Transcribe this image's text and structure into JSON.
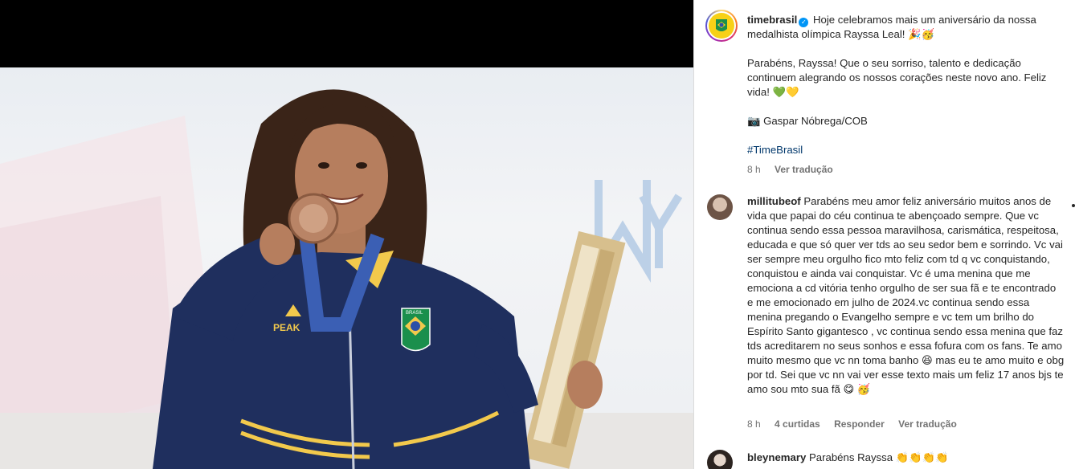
{
  "post": {
    "author": "timebrasil",
    "caption_line1": "Hoje celebramos mais um aniversário da nossa medalhista olímpica Rayssa Leal! 🎉🥳",
    "caption_line2": "Parabéns, Rayssa! Que o seu sorriso, talento e dedicação continuem alegrando os nossos corações neste novo ano. Feliz vida! 💚💛",
    "caption_line3": "📷 Gaspar Nóbrega/COB",
    "hashtag": "#TimeBrasil",
    "time": "8 h",
    "translate": "Ver tradução"
  },
  "comments": [
    {
      "user": "millitubeof",
      "text": "Parabéns meu amor feliz aniversário muitos anos de vida que papai do céu continua te abençoado sempre. Que vc continua sendo essa pessoa maravilhosa, carismática, respeitosa, educada e que só quer ver tds ao seu sedor bem e sorrindo. Vc vai ser sempre meu orgulho fico mto feliz com td q vc conquistando, conquistou e ainda vai conquistar. Vc é uma menina que me emociona a cd vitória tenho orgulho de ser sua fã e te encontrado e me emocionado em julho de 2024.vc continua sendo essa menina pregando o Evangelho sempre e vc tem um brilho do Espírito Santo gigantesco , vc continua sendo essa menina que faz tds acreditarem no seus sonhos e essa fofura com os fans. Te amo muito mesmo que vc nn toma banho 😆 mas eu te amo muito e obg por td. Sei que vc nn vai ver esse texto mais um feliz 17 anos bjs te amo sou mto sua fã 😋 🥳",
      "time": "8 h",
      "likes": "4 curtidas",
      "reply": "Responder",
      "translate": "Ver tradução"
    },
    {
      "user": "bleynemary",
      "text": "Parabéns Rayssa 👏👏👏👏"
    }
  ],
  "photo": {
    "jacket_brand": "PEAK",
    "badge_text": "BRASIL"
  },
  "colors": {
    "link": "#00376b",
    "muted": "#737373",
    "verified": "#0095f6",
    "jacket": "#1f2f5e"
  }
}
